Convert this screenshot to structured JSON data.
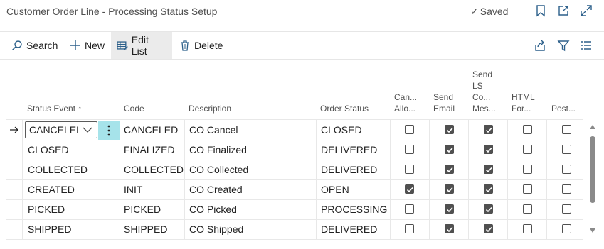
{
  "window": {
    "title": "Customer Order Line - Processing Status Setup",
    "saved_label": "Saved"
  },
  "actions": {
    "search": "Search",
    "new": "New",
    "edit_list": "Edit List",
    "delete": "Delete"
  },
  "table": {
    "columns": {
      "status_event": "Status Event",
      "sort_arrow": "↑",
      "code": "Code",
      "description": "Description",
      "order_status": "Order Status",
      "can_allow": [
        "Can...",
        "Allo..."
      ],
      "send_email": [
        "Send",
        "Email"
      ],
      "send_ls": [
        "Send",
        "LS",
        "Co...",
        "Mes..."
      ],
      "html_for": [
        "HTML",
        "For..."
      ],
      "post": [
        "Post..."
      ]
    },
    "rows": [
      {
        "status_event": "CANCELED",
        "code": "CANCELED",
        "description": "CO Cancel",
        "order_status": "CLOSED",
        "can_allow": false,
        "send_email": true,
        "send_ls": true,
        "html": false,
        "post": false
      },
      {
        "status_event": "CLOSED",
        "code": "FINALIZED",
        "description": "CO Finalized",
        "order_status": "DELIVERED",
        "can_allow": false,
        "send_email": true,
        "send_ls": true,
        "html": false,
        "post": false
      },
      {
        "status_event": "COLLECTED",
        "code": "COLLECTED",
        "description": "CO Collected",
        "order_status": "DELIVERED",
        "can_allow": false,
        "send_email": true,
        "send_ls": true,
        "html": false,
        "post": false
      },
      {
        "status_event": "CREATED",
        "code": "INIT",
        "description": "CO Created",
        "order_status": "OPEN",
        "can_allow": true,
        "send_email": true,
        "send_ls": true,
        "html": false,
        "post": false
      },
      {
        "status_event": "PICKED",
        "code": "PICKED",
        "description": "CO Picked",
        "order_status": "PROCESSING",
        "can_allow": false,
        "send_email": true,
        "send_ls": true,
        "html": false,
        "post": false
      },
      {
        "status_event": "SHIPPED",
        "code": "SHIPPED",
        "description": "CO Shipped",
        "order_status": "DELIVERED",
        "can_allow": false,
        "send_email": true,
        "send_ls": true,
        "html": false,
        "post": false
      }
    ]
  },
  "colors": {
    "selected_accent": "#a6e3ea",
    "text": "#212121",
    "muted": "#505050"
  }
}
